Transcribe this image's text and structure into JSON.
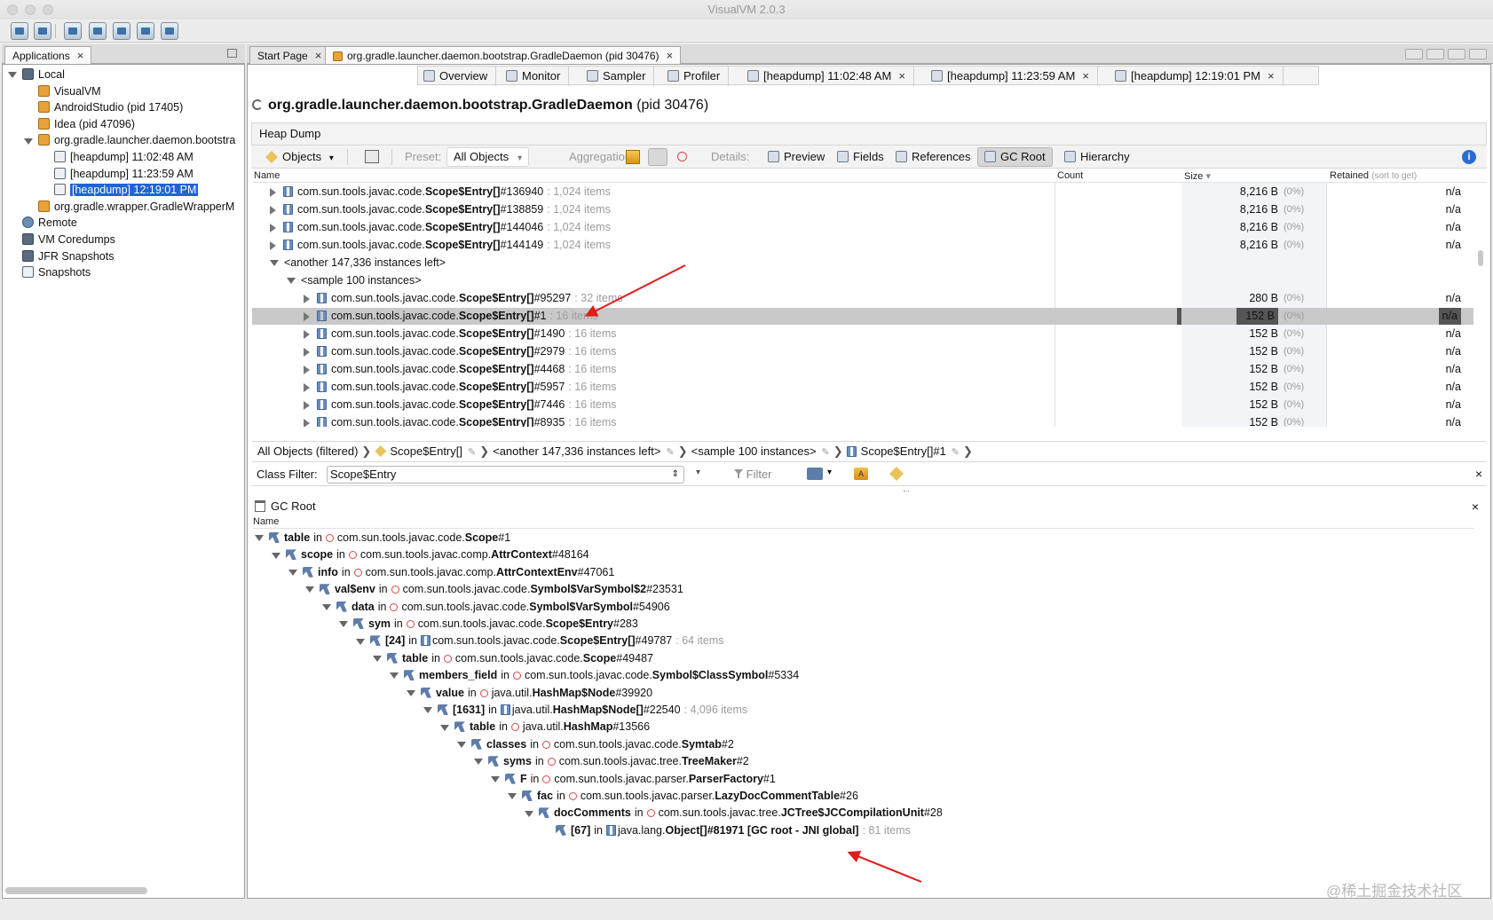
{
  "window": {
    "title": "VisualVM 2.0.3"
  },
  "toolbar": {
    "buttons": [
      "open-icon",
      "save-icon",
      "add-jmx-icon",
      "add-coredump-icon",
      "add-snapshot-icon",
      "thread-dump-icon",
      "heap-dump-icon"
    ]
  },
  "apps_panel": {
    "tab_label": "Applications",
    "tree": [
      {
        "label": "Local",
        "level": 0,
        "icon": "computer-icon",
        "expanded": true
      },
      {
        "label": "VisualVM",
        "level": 1,
        "icon": "visualvm-icon"
      },
      {
        "label": "AndroidStudio (pid 17405)",
        "level": 1,
        "icon": "app-icon"
      },
      {
        "label": "Idea (pid 47096)",
        "level": 1,
        "icon": "app-icon"
      },
      {
        "label": "org.gradle.launcher.daemon.bootstra",
        "level": 1,
        "icon": "app-icon",
        "expanded": true
      },
      {
        "label": "[heapdump] 11:02:48 AM",
        "level": 2,
        "icon": "heapdump-icon"
      },
      {
        "label": "[heapdump] 11:23:59 AM",
        "level": 2,
        "icon": "heapdump-icon"
      },
      {
        "label": "[heapdump] 12:19:01 PM",
        "level": 2,
        "icon": "heapdump-icon",
        "selected": true
      },
      {
        "label": "org.gradle.wrapper.GradleWrapperM",
        "level": 1,
        "icon": "app-icon"
      },
      {
        "label": "Remote",
        "level": 0,
        "icon": "network-icon"
      },
      {
        "label": "VM Coredumps",
        "level": 0,
        "icon": "coredump-icon"
      },
      {
        "label": "JFR Snapshots",
        "level": 0,
        "icon": "jfr-icon"
      },
      {
        "label": "Snapshots",
        "level": 0,
        "icon": "snapshot-icon"
      }
    ]
  },
  "doc_tabs": [
    {
      "label": "Start Page",
      "active": false
    },
    {
      "label": "org.gradle.launcher.daemon.bootstrap.GradleDaemon (pid 30476)",
      "active": true
    }
  ],
  "sub_tabs": [
    "Overview",
    "Monitor",
    "Sampler",
    "Profiler",
    "[heapdump] 11:02:48 AM",
    "[heapdump] 11:23:59 AM",
    "[heapdump] 12:19:01 PM"
  ],
  "app_title": {
    "name": "org.gradle.launcher.daemon.bootstrap.GradleDaemon",
    "pid": "(pid 30476)"
  },
  "heap_dump": {
    "section_label": "Heap Dump",
    "objects_label": "Objects",
    "preset_label": "Preset:",
    "preset_value": "All Objects",
    "aggregation_label": "Aggregation:",
    "details_label": "Details:",
    "details": [
      "Preview",
      "Fields",
      "References",
      "GC Root",
      "Hierarchy"
    ],
    "columns": {
      "name": "Name",
      "count": "Count",
      "size": "Size",
      "retained": "Retained",
      "retained_hint": "(sort to get)"
    },
    "rows": [
      {
        "prefix": "com.sun.tools.javac.code.",
        "bold": "Scope$Entry[]",
        "suffix": "#136940",
        "extra": ": 1,024 items",
        "size": "8,216 B",
        "pct": "(0%)",
        "retained": "n/a",
        "level": 1
      },
      {
        "prefix": "com.sun.tools.javac.code.",
        "bold": "Scope$Entry[]",
        "suffix": "#138859",
        "extra": ": 1,024 items",
        "size": "8,216 B",
        "pct": "(0%)",
        "retained": "n/a",
        "level": 1
      },
      {
        "prefix": "com.sun.tools.javac.code.",
        "bold": "Scope$Entry[]",
        "suffix": "#144046",
        "extra": ": 1,024 items",
        "size": "8,216 B",
        "pct": "(0%)",
        "retained": "n/a",
        "level": 1
      },
      {
        "prefix": "com.sun.tools.javac.code.",
        "bold": "Scope$Entry[]",
        "suffix": "#144149",
        "extra": ": 1,024 items",
        "size": "8,216 B",
        "pct": "(0%)",
        "retained": "n/a",
        "level": 1
      },
      {
        "group": "<another 147,336 instances left>",
        "level": 1
      },
      {
        "group": "<sample 100 instances>",
        "level": 2
      },
      {
        "prefix": "com.sun.tools.javac.code.",
        "bold": "Scope$Entry[]",
        "suffix": "#95297",
        "extra": ": 32 items",
        "size": "280 B",
        "pct": "(0%)",
        "retained": "n/a",
        "level": 3
      },
      {
        "prefix": "com.sun.tools.javac.code.",
        "bold": "Scope$Entry[]",
        "suffix": "#1",
        "extra": ": 16 items",
        "size": "152 B",
        "pct": "(0%)",
        "retained": "n/a",
        "level": 3,
        "selected": true
      },
      {
        "prefix": "com.sun.tools.javac.code.",
        "bold": "Scope$Entry[]",
        "suffix": "#1490",
        "extra": ": 16 items",
        "size": "152 B",
        "pct": "(0%)",
        "retained": "n/a",
        "level": 3
      },
      {
        "prefix": "com.sun.tools.javac.code.",
        "bold": "Scope$Entry[]",
        "suffix": "#2979",
        "extra": ": 16 items",
        "size": "152 B",
        "pct": "(0%)",
        "retained": "n/a",
        "level": 3
      },
      {
        "prefix": "com.sun.tools.javac.code.",
        "bold": "Scope$Entry[]",
        "suffix": "#4468",
        "extra": ": 16 items",
        "size": "152 B",
        "pct": "(0%)",
        "retained": "n/a",
        "level": 3
      },
      {
        "prefix": "com.sun.tools.javac.code.",
        "bold": "Scope$Entry[]",
        "suffix": "#5957",
        "extra": ": 16 items",
        "size": "152 B",
        "pct": "(0%)",
        "retained": "n/a",
        "level": 3
      },
      {
        "prefix": "com.sun.tools.javac.code.",
        "bold": "Scope$Entry[]",
        "suffix": "#7446",
        "extra": ": 16 items",
        "size": "152 B",
        "pct": "(0%)",
        "retained": "n/a",
        "level": 3
      },
      {
        "prefix": "com.sun.tools.javac.code.",
        "bold": "Scope$Entry[]",
        "suffix": "#8935",
        "extra": ": 16 items",
        "size": "152 B",
        "pct": "(0%)",
        "retained": "n/a",
        "level": 3
      }
    ]
  },
  "breadcrumb": [
    "All Objects (filtered)",
    "Scope$Entry[]",
    "<another 147,336 instances left>",
    "<sample 100 instances>",
    "Scope$Entry[]#1"
  ],
  "class_filter": {
    "label": "Class Filter:",
    "value": "Scope$Entry",
    "filter_button": "Filter"
  },
  "gc_root": {
    "title": "GC Root",
    "column": "Name",
    "rows": [
      {
        "field": "table",
        "in": "in",
        "kind": "obj",
        "pre": "com.sun.tools.javac.code.",
        "cls": "Scope",
        "id": "#1",
        "extra": ""
      },
      {
        "field": "scope",
        "in": "in",
        "kind": "obj",
        "pre": "com.sun.tools.javac.comp.",
        "cls": "AttrContext",
        "id": "#48164",
        "extra": ""
      },
      {
        "field": "info",
        "in": "in",
        "kind": "obj",
        "pre": "com.sun.tools.javac.comp.",
        "cls": "AttrContextEnv",
        "id": "#47061",
        "extra": ""
      },
      {
        "field": "val$env",
        "in": "in",
        "kind": "obj",
        "pre": "com.sun.tools.javac.code.",
        "cls": "Symbol$VarSymbol$2",
        "id": "#23531",
        "extra": ""
      },
      {
        "field": "data",
        "in": "in",
        "kind": "obj",
        "pre": "com.sun.tools.javac.code.",
        "cls": "Symbol$VarSymbol",
        "id": "#54906",
        "extra": ""
      },
      {
        "field": "sym",
        "in": "in",
        "kind": "obj",
        "pre": "com.sun.tools.javac.code.",
        "cls": "Scope$Entry",
        "id": "#283",
        "extra": ""
      },
      {
        "field": "[24]",
        "in": "in",
        "kind": "arr",
        "pre": "com.sun.tools.javac.code.",
        "cls": "Scope$Entry[]",
        "id": "#49787",
        "extra": ": 64 items"
      },
      {
        "field": "table",
        "in": "in",
        "kind": "obj",
        "pre": "com.sun.tools.javac.code.",
        "cls": "Scope",
        "id": "#49487",
        "extra": ""
      },
      {
        "field": "members_field",
        "in": "in",
        "kind": "obj",
        "pre": "com.sun.tools.javac.code.",
        "cls": "Symbol$ClassSymbol",
        "id": "#5334",
        "extra": ""
      },
      {
        "field": "value",
        "in": "in",
        "kind": "obj",
        "pre": "java.util.",
        "cls": "HashMap$Node",
        "id": "#39920",
        "extra": ""
      },
      {
        "field": "[1631]",
        "in": "in",
        "kind": "arr",
        "pre": "java.util.",
        "cls": "HashMap$Node[]",
        "id": "#22540",
        "extra": ": 4,096 items"
      },
      {
        "field": "table",
        "in": "in",
        "kind": "obj",
        "pre": "java.util.",
        "cls": "HashMap",
        "id": "#13566",
        "extra": ""
      },
      {
        "field": "classes",
        "in": "in",
        "kind": "obj",
        "pre": "com.sun.tools.javac.code.",
        "cls": "Symtab",
        "id": "#2",
        "extra": ""
      },
      {
        "field": "syms",
        "in": "in",
        "kind": "obj",
        "pre": "com.sun.tools.javac.tree.",
        "cls": "TreeMaker",
        "id": "#2",
        "extra": ""
      },
      {
        "field": "F",
        "in": "in",
        "kind": "obj",
        "pre": "com.sun.tools.javac.parser.",
        "cls": "ParserFactory",
        "id": "#1",
        "extra": ""
      },
      {
        "field": "fac",
        "in": "in",
        "kind": "obj",
        "pre": "com.sun.tools.javac.parser.",
        "cls": "LazyDocCommentTable",
        "id": "#26",
        "extra": ""
      },
      {
        "field": "docComments",
        "in": "in",
        "kind": "obj",
        "pre": "com.sun.tools.javac.tree.",
        "cls": "JCTree$JCCompilationUnit",
        "id": "#28",
        "extra": ""
      },
      {
        "field": "[67]",
        "in": "in",
        "kind": "arr",
        "pre": "java.lang.",
        "cls": "Object[]",
        "id": "#81971 [GC root - JNI global]",
        "extra": ": 81 items",
        "leaf": true
      }
    ]
  },
  "watermark": "@稀土掘金技术社区",
  "colors": {
    "selection": "#1f63d6",
    "row_selected": "#c9c9c9",
    "accent_red": "#e31b1b"
  }
}
